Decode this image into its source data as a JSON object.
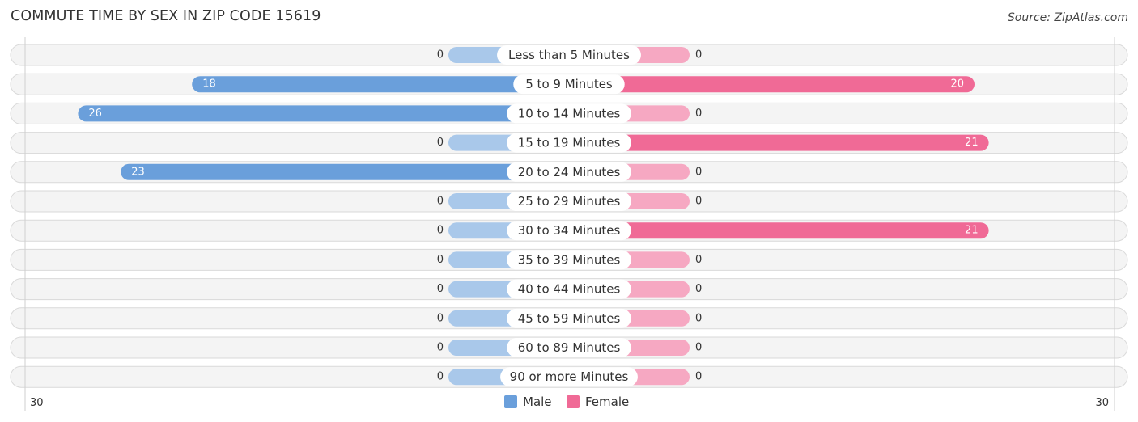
{
  "header": {
    "title": "COMMUTE TIME BY SEX IN ZIP CODE 15619",
    "source": "Source: ZipAtlas.com"
  },
  "colors": {
    "male_strong": "#6a9fdb",
    "male_light": "#a9c8ea",
    "female_strong": "#f06a96",
    "female_light": "#f6a8c2"
  },
  "chart_data": {
    "type": "bar",
    "orientation": "horizontal-diverging",
    "title": "COMMUTE TIME BY SEX IN ZIP CODE 15619",
    "categories": [
      "Less than 5 Minutes",
      "5 to 9 Minutes",
      "10 to 14 Minutes",
      "15 to 19 Minutes",
      "20 to 24 Minutes",
      "25 to 29 Minutes",
      "30 to 34 Minutes",
      "35 to 39 Minutes",
      "40 to 44 Minutes",
      "45 to 59 Minutes",
      "60 to 89 Minutes",
      "90 or more Minutes"
    ],
    "series": [
      {
        "name": "Male",
        "values": [
          0,
          18,
          26,
          0,
          23,
          0,
          0,
          0,
          0,
          0,
          0,
          0
        ]
      },
      {
        "name": "Female",
        "values": [
          0,
          20,
          0,
          21,
          0,
          0,
          21,
          0,
          0,
          0,
          0,
          0
        ]
      }
    ],
    "xlim": [
      -30,
      30
    ],
    "axis_tick_labels": {
      "left": "30",
      "right": "30"
    },
    "legend": {
      "position": "bottom-center",
      "entries": [
        "Male",
        "Female"
      ]
    },
    "grid": false
  }
}
